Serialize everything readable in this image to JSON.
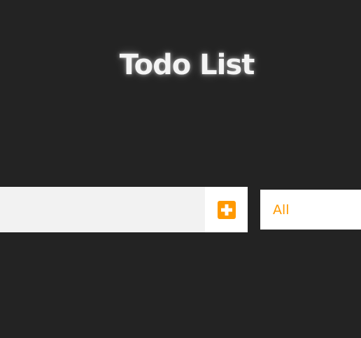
{
  "header": {
    "title": "Todo List"
  },
  "form": {
    "input_value": "",
    "input_placeholder": "",
    "add_button_icon": "plus-square-icon",
    "accent_color": "#ff9900"
  },
  "filter": {
    "selected": "All"
  },
  "colors": {
    "background": "#232323",
    "input_background": "#f2f2f2",
    "accent": "#ff9900"
  }
}
